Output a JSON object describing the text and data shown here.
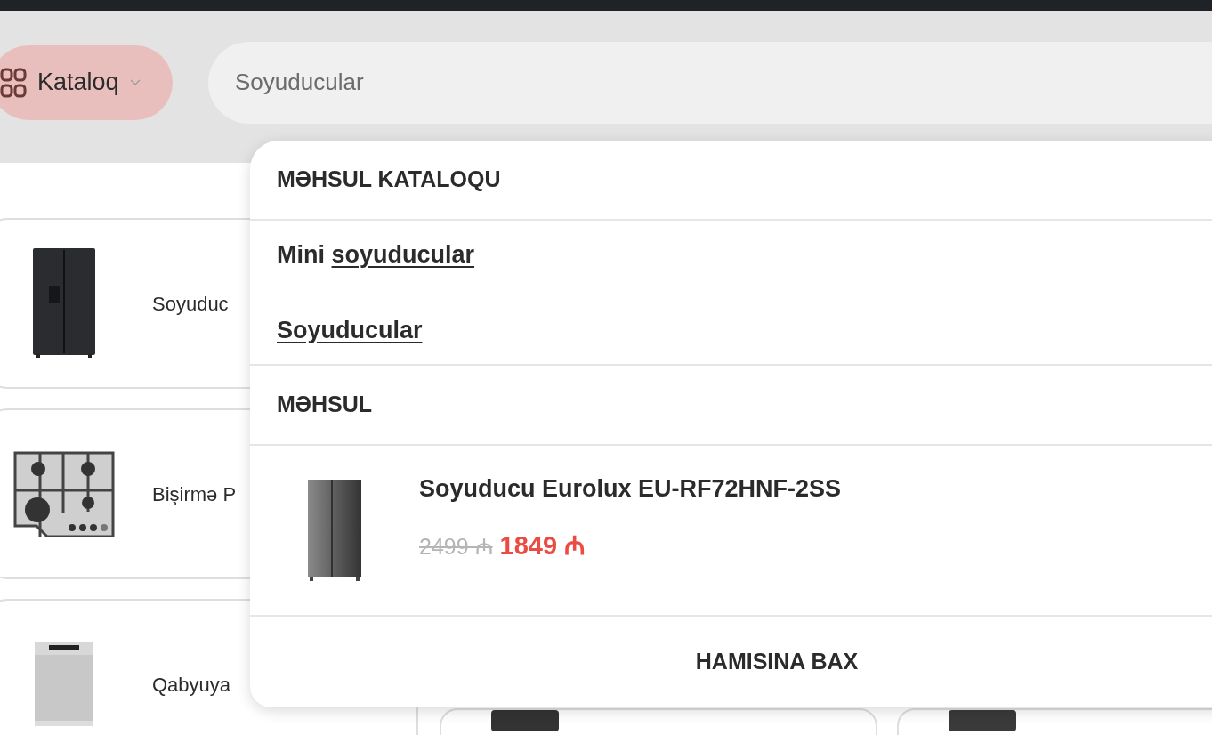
{
  "header": {
    "catalog_button": {
      "label": "Kataloq"
    },
    "search": {
      "value": "Soyuducular"
    }
  },
  "categories": [
    {
      "kind": "fridge",
      "label": "Soyuduc"
    },
    {
      "kind": "hob",
      "label": "Bişirmə P"
    },
    {
      "kind": "dishwasher",
      "label": "Qabyuya"
    }
  ],
  "dropdown": {
    "catalog_heading": "MƏHSUL KATALOQU",
    "catalog_links": [
      {
        "prefix": "Mini ",
        "match": "soyuducular"
      },
      {
        "match": "Soyuducular"
      }
    ],
    "product_heading": "MƏHSUL",
    "products": [
      {
        "name": "Soyuducu Eurolux EU-RF72HNF-2SS",
        "old_price": "2499 ₼",
        "price": "1849 ₼"
      }
    ],
    "view_all": "HAMISINA BAX"
  }
}
